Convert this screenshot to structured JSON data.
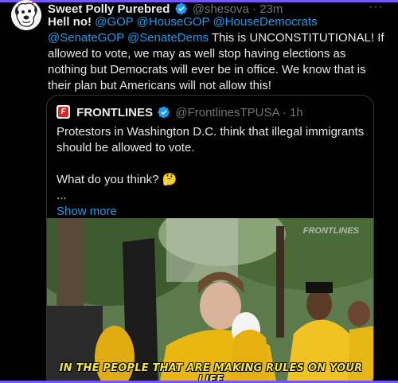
{
  "tweet": {
    "display_name": "Sweet Polly Purebred",
    "handle": "@shesova",
    "separator": "·",
    "time": "23m",
    "more_label": "···",
    "text_intro": "Hell no! ",
    "mentions": [
      "@GOP",
      "@HouseGOP",
      "@HouseDemocrats",
      "@SenateGOP",
      "@SenateDems"
    ],
    "text_body": " This is UNCONSTITUTIONAL! If allowed to vote, we may as well stop having elections as nothing but Democrats will ever be in office. We know that is their plan but Americans will not allow this!"
  },
  "quote": {
    "display_name": "FRONTLINES",
    "handle": "@FrontlinesTPUSA",
    "separator": "·",
    "time": "1h",
    "logo_letter": "F",
    "paragraph_1": "Protestors in Washington D.C. think that illegal immigrants should be allowed to vote.",
    "paragraph_2": "What do you think? 🤔",
    "ellipsis": "...",
    "show_more": "Show more",
    "video_caption": "IN THE PEOPLE THAT ARE MAKING RULES ON YOUR LIFE",
    "watermark": "FRONTLINES"
  },
  "colors": {
    "accent": "#1d9bf0",
    "verified": "#1d9bf0",
    "selection_bar": "#7856ff",
    "caption": "#f4e544"
  }
}
